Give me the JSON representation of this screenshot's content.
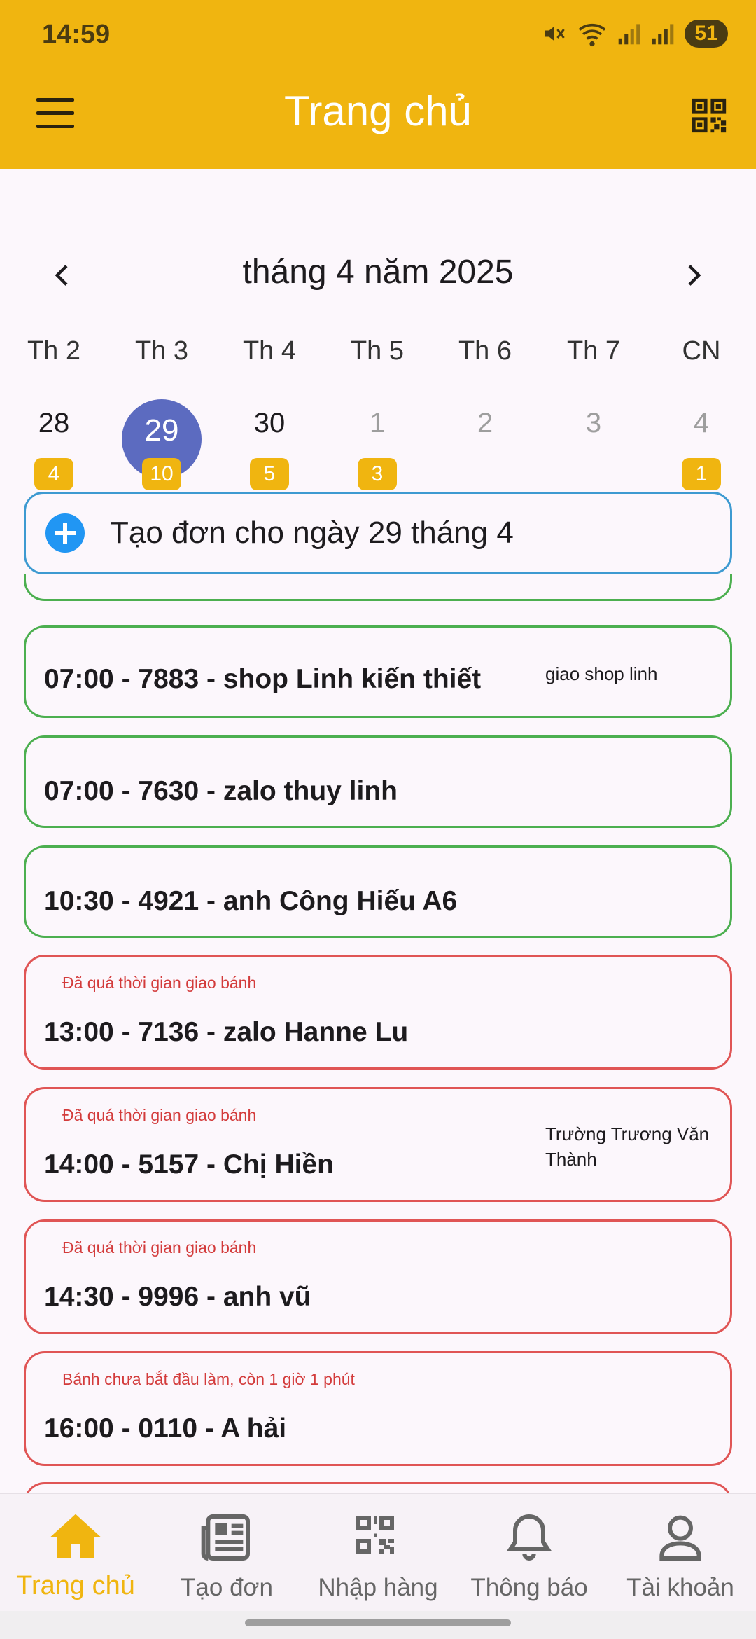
{
  "status_bar": {
    "time": "14:59",
    "battery": "51"
  },
  "app_bar": {
    "title": "Trang chủ"
  },
  "calendar": {
    "month_label": "tháng 4 năm 2025",
    "weekdays": [
      "Th 2",
      "Th 3",
      "Th 4",
      "Th 5",
      "Th 6",
      "Th 7",
      "CN"
    ],
    "days": [
      {
        "num": "28",
        "badge": "4"
      },
      {
        "num": "29",
        "badge": "10",
        "selected": true
      },
      {
        "num": "30",
        "badge": "5"
      },
      {
        "num": "1",
        "badge": "3"
      },
      {
        "num": "2",
        "badge": ""
      },
      {
        "num": "3",
        "badge": ""
      },
      {
        "num": "4",
        "badge": "1"
      }
    ]
  },
  "create_order": {
    "label": "Tạo đơn cho ngày 29 tháng 4"
  },
  "orders": [
    {
      "title": "07:00 - 7883 - shop Linh kiến thiết",
      "note": "giao shop linh",
      "warn": ""
    },
    {
      "title": "07:00 - 7630 - zalo  thuy linh",
      "note": "",
      "warn": ""
    },
    {
      "title": "10:30 - 4921 - anh Công Hiếu A6",
      "note": "",
      "warn": ""
    },
    {
      "title": "13:00 - 7136 - zalo Hanne Lu",
      "note": "",
      "warn": "Đã quá thời gian giao bánh"
    },
    {
      "title": "14:00 - 5157 - Chị Hiền",
      "note": "Trường Trương Văn Thành",
      "warn": "Đã quá thời gian giao bánh"
    },
    {
      "title": "14:30 - 9996 - anh vũ",
      "note": "",
      "warn": "Đã quá thời gian giao bánh"
    },
    {
      "title": "16:00 - 0110 - A hải",
      "note": "",
      "warn": "Bánh chưa bắt đầu làm, còn 1 giờ 1 phút"
    }
  ],
  "bottom_nav": {
    "items": [
      {
        "label": "Trang chủ",
        "icon": "home-icon",
        "active": true
      },
      {
        "label": "Tạo đơn",
        "icon": "newspaper-icon"
      },
      {
        "label": "Nhập hàng",
        "icon": "qr-code-icon"
      },
      {
        "label": "Thông báo",
        "icon": "bell-icon"
      },
      {
        "label": "Tài khoản",
        "icon": "account-icon"
      }
    ]
  },
  "colors": {
    "primary": "#f0b510",
    "selected_day": "#5c6bc0",
    "ok_border": "#4caf50",
    "late_border": "#e05555",
    "create_border": "#3d9ad1"
  }
}
